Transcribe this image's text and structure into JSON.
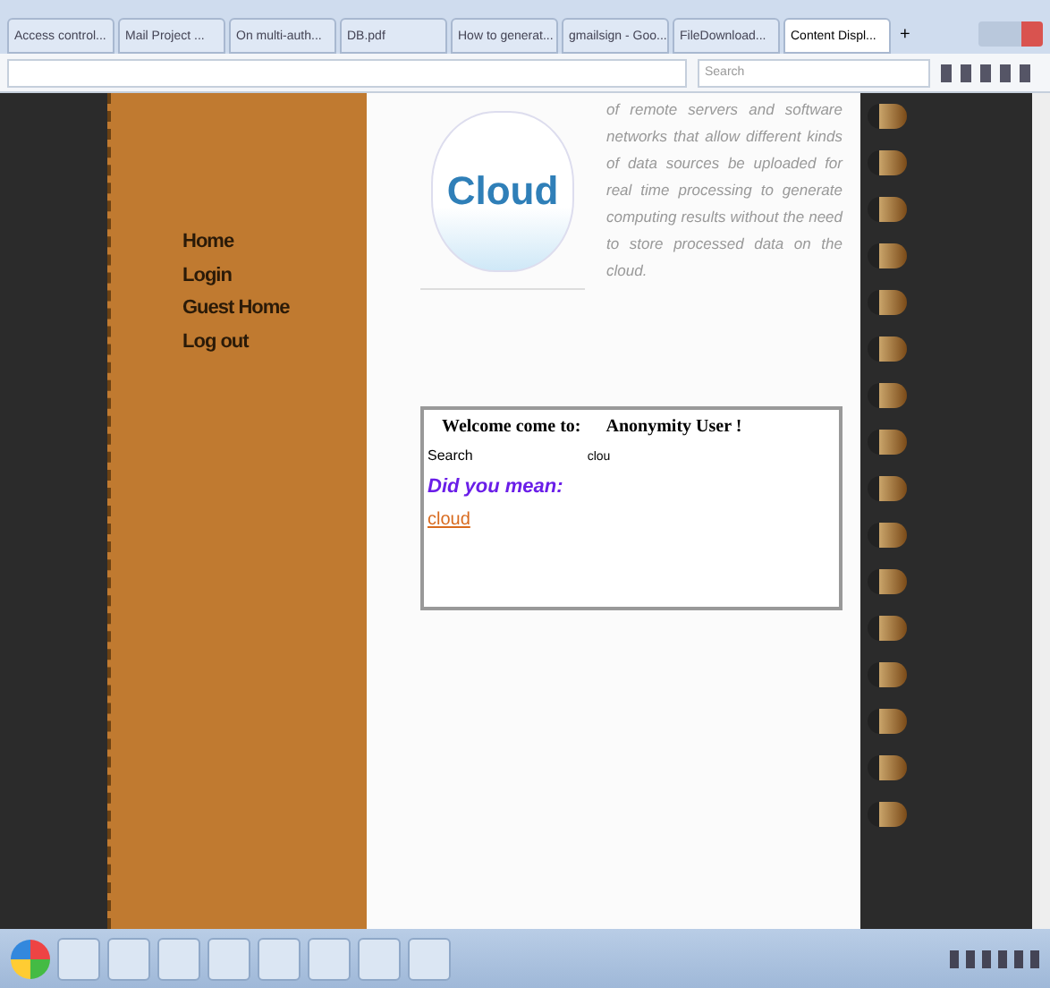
{
  "browser": {
    "tabs": [
      {
        "label": "Access control...",
        "selected": false
      },
      {
        "label": "Mail Project ...",
        "selected": false
      },
      {
        "label": "On multi-auth...",
        "selected": false
      },
      {
        "label": "DB.pdf",
        "selected": false
      },
      {
        "label": "How to generat...",
        "selected": false
      },
      {
        "label": "gmailsign - Goo...",
        "selected": false
      },
      {
        "label": "FileDownload...",
        "selected": false
      },
      {
        "label": "Content Displ...",
        "selected": true
      }
    ],
    "new_tab": "+",
    "search_placeholder": "Search"
  },
  "nav": {
    "items": [
      "Home",
      "Login",
      "Guest Home",
      "Log out"
    ]
  },
  "logo": {
    "text": "Cloud"
  },
  "intro": "of remote servers and software networks that allow different kinds of data sources be uploaded for real time processing to generate computing results without the need to store processed data on the cloud.",
  "panel": {
    "welcome": "Welcome come to:",
    "user": "Anonymity User !",
    "search_label": "Search",
    "search_value": "clou",
    "suggest_heading": "Did you mean:",
    "suggestion": "cloud"
  }
}
